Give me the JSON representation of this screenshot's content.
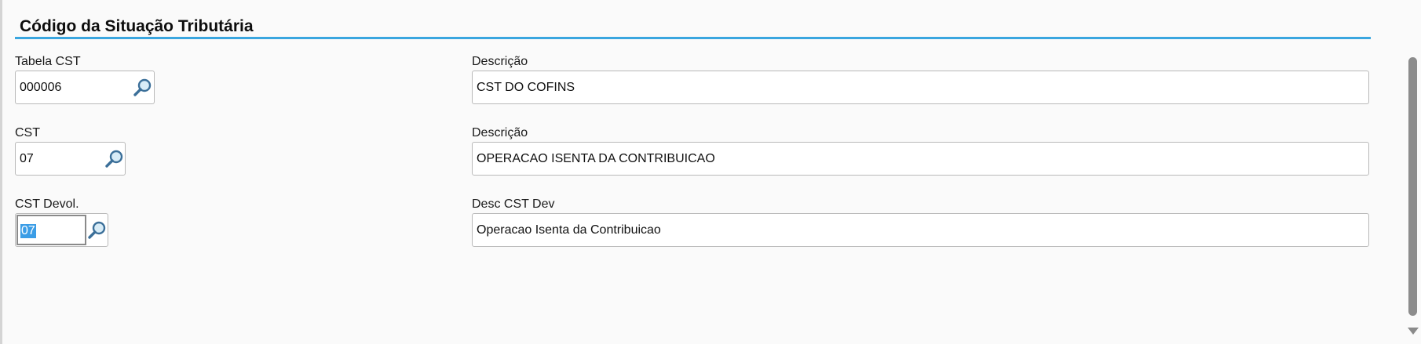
{
  "section": {
    "title": "Código da Situação Tributária"
  },
  "fields": {
    "tabela_cst": {
      "label": "Tabela CST",
      "value": "000006"
    },
    "tabela_desc": {
      "label": "Descrição",
      "value": "CST DO COFINS"
    },
    "cst": {
      "label": "CST",
      "value": "07"
    },
    "cst_desc": {
      "label": "Descrição",
      "value": "OPERACAO ISENTA DA CONTRIBUICAO"
    },
    "cst_devol": {
      "label": "CST Devol.",
      "value": "07"
    },
    "desc_cst_dev": {
      "label": "Desc CST Dev",
      "value": "Operacao Isenta da Contribuicao"
    }
  },
  "icons": {
    "lookup": "magnifier-icon",
    "scroll_down": "triangle-down-icon"
  },
  "colors": {
    "accent": "#3aa6df",
    "selection": "#3b9de6"
  }
}
